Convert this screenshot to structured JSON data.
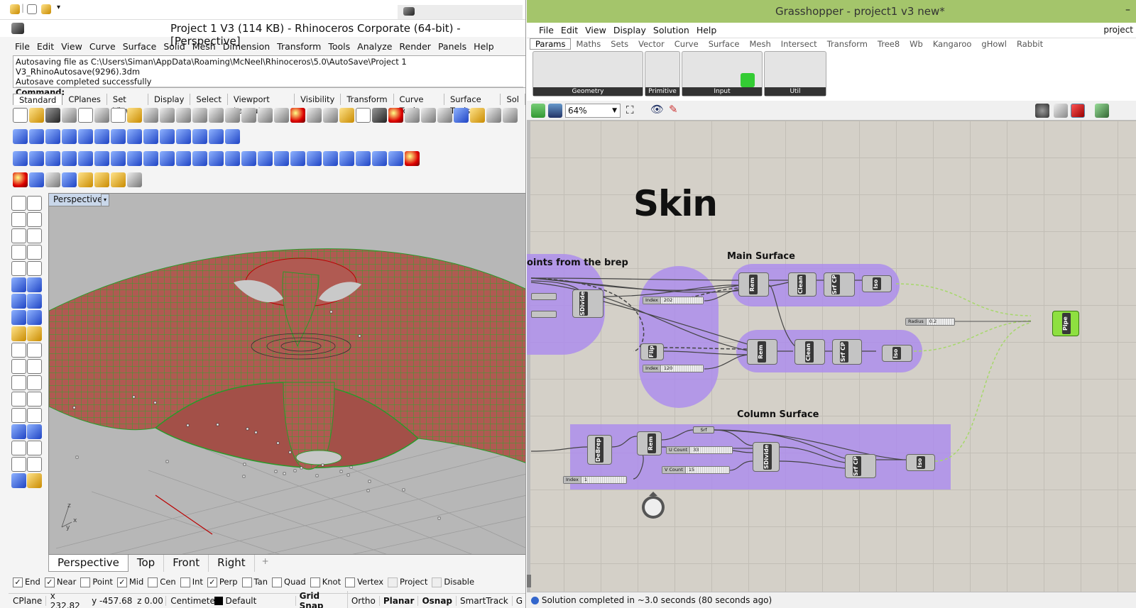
{
  "rhino": {
    "title": "Project 1 V3 (114 KB) - Rhinoceros Corporate (64-bit) - [Perspective]",
    "menu": [
      "File",
      "Edit",
      "View",
      "Curve",
      "Surface",
      "Solid",
      "Mesh",
      "Dimension",
      "Transform",
      "Tools",
      "Analyze",
      "Render",
      "Panels",
      "Help"
    ],
    "command_lines": [
      "Autosaving file as C:\\Users\\Siman\\AppData\\Roaming\\McNeel\\Rhinoceros\\5.0\\AutoSave\\Project 1 V3_RhinoAutosave(9296).3dm",
      "Autosave completed successfully"
    ],
    "command_label": "Command:",
    "toolbar_tabs": [
      "Standard",
      "CPlanes",
      "Set View",
      "Display",
      "Select",
      "Viewport Layout",
      "Visibility",
      "Transform",
      "Curve Tools",
      "Surface Tools",
      "Sol"
    ],
    "viewport_label": "Perspective",
    "axis_labels": [
      "z",
      "y",
      "x"
    ],
    "view_tabs": [
      "Perspective",
      "Top",
      "Front",
      "Right"
    ],
    "view_tab_add": "+",
    "osnaps": [
      {
        "label": "End",
        "checked": true
      },
      {
        "label": "Near",
        "checked": true
      },
      {
        "label": "Point",
        "checked": false
      },
      {
        "label": "Mid",
        "checked": true
      },
      {
        "label": "Cen",
        "checked": false
      },
      {
        "label": "Int",
        "checked": false
      },
      {
        "label": "Perp",
        "checked": true
      },
      {
        "label": "Tan",
        "checked": false
      },
      {
        "label": "Quad",
        "checked": false
      },
      {
        "label": "Knot",
        "checked": false
      },
      {
        "label": "Vertex",
        "checked": false
      },
      {
        "label": "Project",
        "checked": false
      },
      {
        "label": "Disable",
        "checked": false
      }
    ],
    "status": {
      "cplane": "CPlane",
      "x": "x 232.82",
      "y": "y -457.68",
      "z": "z 0.00",
      "units": "Centimeter",
      "layer": "Default",
      "toggles": [
        "Grid Snap",
        "Ortho",
        "Planar",
        "Osnap",
        "SmartTrack",
        "G"
      ]
    }
  },
  "gh": {
    "title": "Grasshopper - project1 v3 new*",
    "menu": [
      "File",
      "Edit",
      "View",
      "Display",
      "Solution",
      "Help"
    ],
    "doc_name": "project",
    "tabs": [
      "Params",
      "Maths",
      "Sets",
      "Vector",
      "Curve",
      "Surface",
      "Mesh",
      "Intersect",
      "Transform",
      "Tree8",
      "Wb",
      "Kangaroo",
      "gHowl",
      "Rabbit"
    ],
    "panels": [
      "Geometry",
      "Primitive",
      "Input",
      "Util"
    ],
    "zoom": "64%",
    "canvas_title": "Skin",
    "groups": {
      "left": "oints from the brep",
      "main": "Main Surface",
      "column": "Column Surface"
    },
    "nodes": {
      "sdivide": "SDivide",
      "rem": "Rem",
      "clean": "Clean",
      "srfcp": "Srf CP",
      "iso": "Iso",
      "flip": "Flip",
      "debrep": "DeBrep",
      "pipe": "Pipe",
      "srf": "Srf"
    },
    "sliders": [
      {
        "name": "Index",
        "value": "202"
      },
      {
        "name": "Index",
        "value": "120"
      },
      {
        "name": "Radius",
        "value": "0.2"
      },
      {
        "name": "U Count",
        "value": "33"
      },
      {
        "name": "V Count",
        "value": "15"
      },
      {
        "name": "Index",
        "value": "1"
      }
    ],
    "status": "Solution completed in ~3.0 seconds (80 seconds ago)"
  }
}
